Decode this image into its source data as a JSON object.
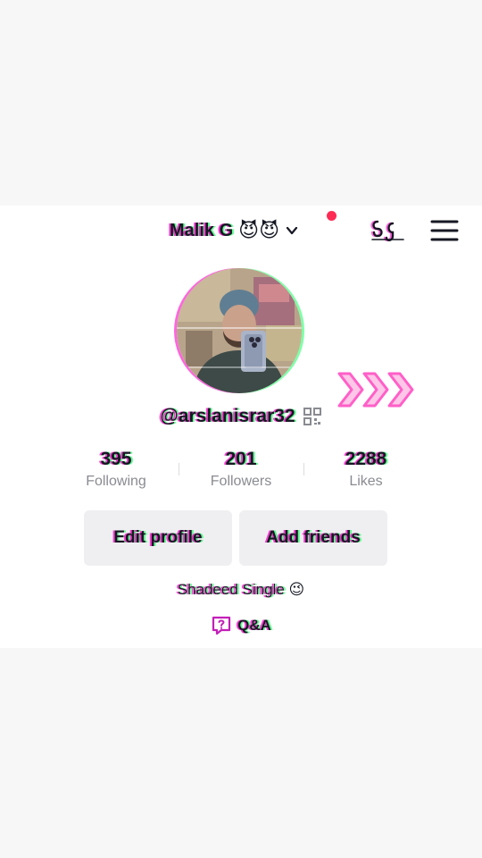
{
  "header": {
    "account_name": "Malik G",
    "account_emoji": "😈😈"
  },
  "profile": {
    "username": "@arslanisrar32",
    "bio": "Shadeed Single",
    "bio_emoji": "😉"
  },
  "stats": [
    {
      "value": "395",
      "label": "Following"
    },
    {
      "value": "201",
      "label": "Followers"
    },
    {
      "value": "2288",
      "label": "Likes"
    }
  ],
  "buttons": {
    "edit_profile": "Edit profile",
    "add_friends": "Add friends"
  },
  "qa": {
    "label": "Q&A"
  },
  "icons": {
    "account_switch": "chevron-down-icon",
    "notification": "red-dot-badge",
    "creator_tools": "creator-tools-icon",
    "menu": "hamburger-menu-icon",
    "qr": "qr-code-icon",
    "qa": "question-bubble-icon",
    "decoration": "triple-chevron-icon"
  },
  "colors": {
    "background": "#f7f7f7",
    "panel": "#ffffff",
    "text": "#161823",
    "muted": "#8a8b91",
    "badge": "#fe2c55",
    "button_bg": "#efeff1",
    "deco_glow": "#ff5fc8"
  }
}
